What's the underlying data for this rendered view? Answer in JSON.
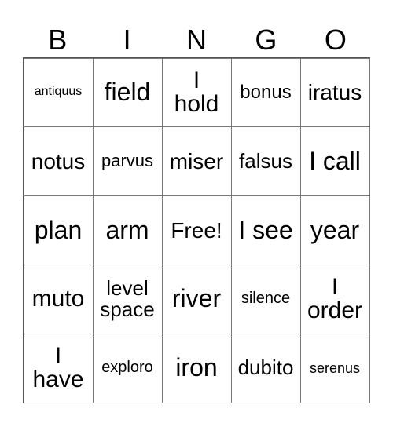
{
  "header": [
    "B",
    "I",
    "N",
    "G",
    "O"
  ],
  "cells": [
    [
      "antiquus",
      "field",
      "I\nhold",
      "bonus",
      "iratus"
    ],
    [
      "notus",
      "parvus",
      "miser",
      "falsus",
      "I call"
    ],
    [
      "plan",
      "arm",
      "Free!",
      "I see",
      "year"
    ],
    [
      "muto",
      "level\nspace",
      "river",
      "silence",
      "I\norder"
    ],
    [
      "I\nhave",
      "exploro",
      "iron",
      "dubito",
      "serenus"
    ]
  ]
}
